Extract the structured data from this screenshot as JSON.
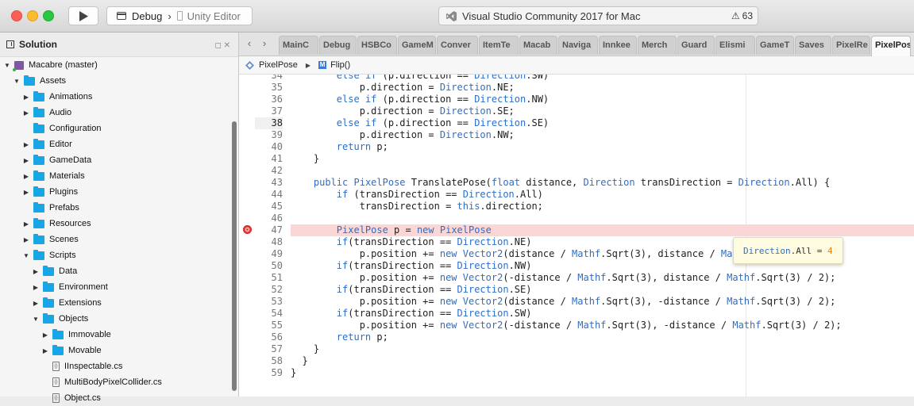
{
  "window": {
    "config_label": "Debug",
    "device_label": "Unity Editor",
    "status_text": "Visual Studio Community 2017 for Mac",
    "warning_count": "63"
  },
  "solution": {
    "title": "Solution",
    "controls": "◻ ✕",
    "tree": [
      {
        "label": "Macabre (master)",
        "depth": 0,
        "kind": "project",
        "arrow": "down"
      },
      {
        "label": "Assets",
        "depth": 1,
        "kind": "folder",
        "arrow": "down"
      },
      {
        "label": "Animations",
        "depth": 2,
        "kind": "folder",
        "arrow": "right"
      },
      {
        "label": "Audio",
        "depth": 2,
        "kind": "folder",
        "arrow": "right"
      },
      {
        "label": "Configuration",
        "depth": 2,
        "kind": "folder",
        "arrow": ""
      },
      {
        "label": "Editor",
        "depth": 2,
        "kind": "folder",
        "arrow": "right"
      },
      {
        "label": "GameData",
        "depth": 2,
        "kind": "folder",
        "arrow": "right"
      },
      {
        "label": "Materials",
        "depth": 2,
        "kind": "folder",
        "arrow": "right"
      },
      {
        "label": "Plugins",
        "depth": 2,
        "kind": "folder",
        "arrow": "right"
      },
      {
        "label": "Prefabs",
        "depth": 2,
        "kind": "folder",
        "arrow": ""
      },
      {
        "label": "Resources",
        "depth": 2,
        "kind": "folder",
        "arrow": "right"
      },
      {
        "label": "Scenes",
        "depth": 2,
        "kind": "folder",
        "arrow": "right"
      },
      {
        "label": "Scripts",
        "depth": 2,
        "kind": "folder",
        "arrow": "down"
      },
      {
        "label": "Data",
        "depth": 3,
        "kind": "folder",
        "arrow": "right"
      },
      {
        "label": "Environment",
        "depth": 3,
        "kind": "folder",
        "arrow": "right"
      },
      {
        "label": "Extensions",
        "depth": 3,
        "kind": "folder",
        "arrow": "right"
      },
      {
        "label": "Objects",
        "depth": 3,
        "kind": "folder",
        "arrow": "down"
      },
      {
        "label": "Immovable",
        "depth": 4,
        "kind": "folder",
        "arrow": "right"
      },
      {
        "label": "Movable",
        "depth": 4,
        "kind": "folder",
        "arrow": "right"
      },
      {
        "label": "IInspectable.cs",
        "depth": 4,
        "kind": "file",
        "arrow": ""
      },
      {
        "label": "MultiBodyPixelCollider.cs",
        "depth": 4,
        "kind": "file",
        "arrow": ""
      },
      {
        "label": "Object.cs",
        "depth": 4,
        "kind": "file",
        "arrow": ""
      }
    ]
  },
  "tabs": [
    "MainC",
    "Debug",
    "HSBCo",
    "GameM",
    "Conver",
    "ItemTe",
    "Macab",
    "Naviga",
    "Innkee",
    "Merch",
    "Guard",
    "Elismi",
    "GameT",
    "Saves",
    "PixelRe",
    "PixelPose"
  ],
  "active_tab": "PixelPose",
  "breadcrumb": {
    "class_name": "PixelPose",
    "method_name": "Flip()"
  },
  "code": [
    {
      "n": "34",
      "t": "        else if (p.direction == Direction.SW)"
    },
    {
      "n": "35",
      "t": "            p.direction = Direction.NE;"
    },
    {
      "n": "36",
      "t": "        else if (p.direction == Direction.NW)"
    },
    {
      "n": "37",
      "t": "            p.direction = Direction.SE;"
    },
    {
      "n": "38",
      "t": "        else if (p.direction == Direction.SE)"
    },
    {
      "n": "39",
      "t": "            p.direction = Direction.NW;"
    },
    {
      "n": "40",
      "t": "        return p;"
    },
    {
      "n": "41",
      "t": "    }"
    },
    {
      "n": "42",
      "t": ""
    },
    {
      "n": "43",
      "t": "    public PixelPose TranslatePose(float distance, Direction transDirection = Direction.All) {"
    },
    {
      "n": "44",
      "t": "        if (transDirection == Direction.All)"
    },
    {
      "n": "45",
      "t": "            transDirection = this.direction;"
    },
    {
      "n": "46",
      "t": ""
    },
    {
      "n": "47",
      "t": "        PixelPose p = new PixelPose"
    },
    {
      "n": "48",
      "t": "        if(transDirection == Direction.NE)"
    },
    {
      "n": "49",
      "t": "            p.position += new Vector2(distance / Mathf.Sqrt(3), distance / Mathf.Sqrt(3) / 2);"
    },
    {
      "n": "50",
      "t": "        if(transDirection == Direction.NW)"
    },
    {
      "n": "51",
      "t": "            p.position += new Vector2(-distance / Mathf.Sqrt(3), distance / Mathf.Sqrt(3) / 2);"
    },
    {
      "n": "52",
      "t": "        if(transDirection == Direction.SE)"
    },
    {
      "n": "53",
      "t": "            p.position += new Vector2(distance / Mathf.Sqrt(3), -distance / Mathf.Sqrt(3) / 2);"
    },
    {
      "n": "54",
      "t": "        if(transDirection == Direction.SW)"
    },
    {
      "n": "55",
      "t": "            p.position += new Vector2(-distance / Mathf.Sqrt(3), -distance / Mathf.Sqrt(3) / 2);"
    },
    {
      "n": "56",
      "t": "        return p;"
    },
    {
      "n": "57",
      "t": "    }"
    },
    {
      "n": "58",
      "t": "  }"
    },
    {
      "n": "59",
      "t": "}"
    }
  ],
  "breakpoint_line": "47",
  "current_line": "38",
  "tooltip": {
    "key": "Direction",
    "member": ".All = ",
    "value": "4"
  }
}
